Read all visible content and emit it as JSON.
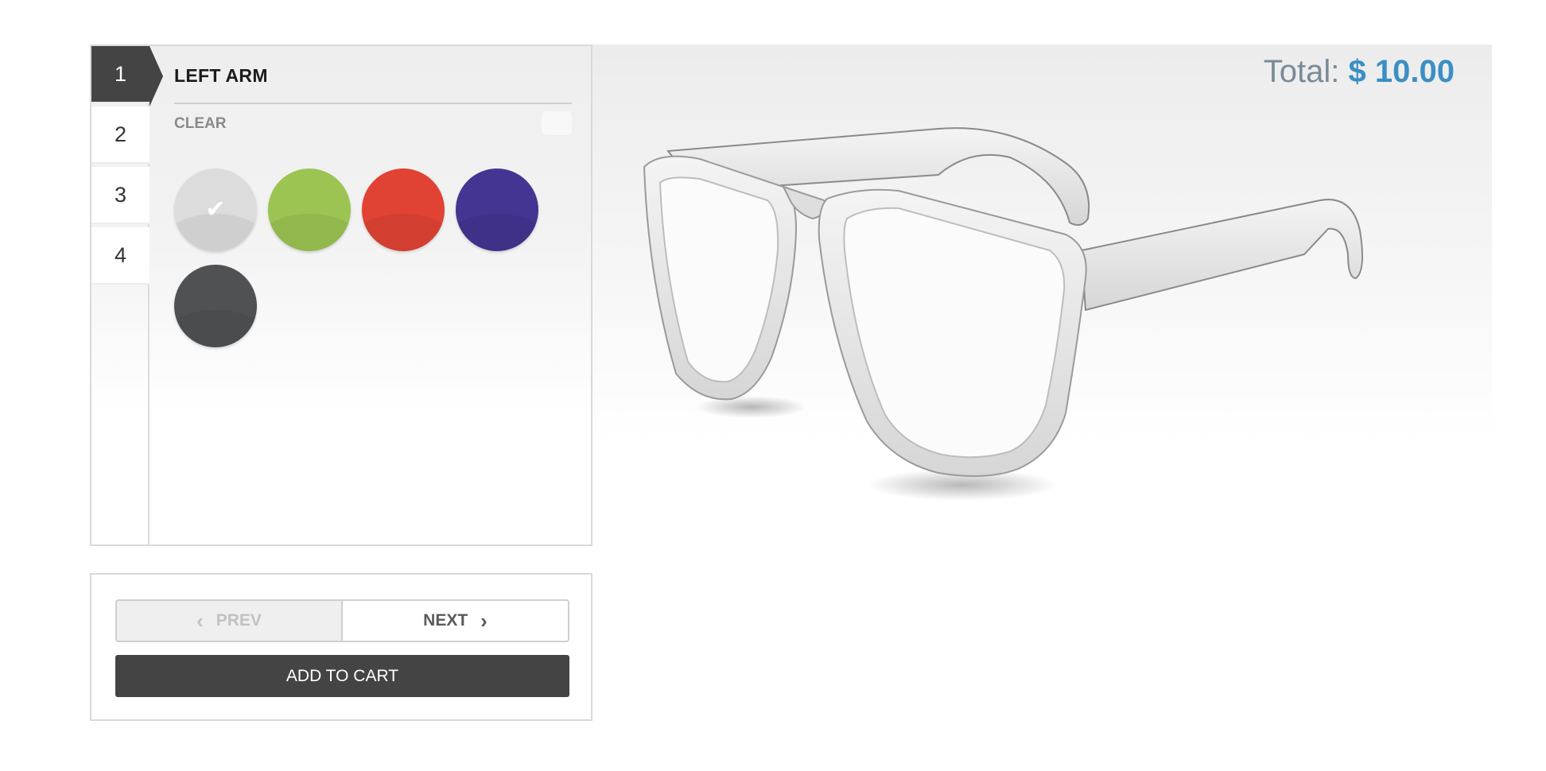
{
  "steps": [
    {
      "label": "1"
    },
    {
      "label": "2"
    },
    {
      "label": "3"
    },
    {
      "label": "4"
    }
  ],
  "active_step": 1,
  "part": {
    "title": "LEFT ARM",
    "clear_label": "CLEAR"
  },
  "swatches": [
    {
      "name": "white",
      "color": "#dcdcdc",
      "selected": true,
      "check_glyph": "✔"
    },
    {
      "name": "green",
      "color": "#9cc452",
      "selected": false
    },
    {
      "name": "red",
      "color": "#e04234",
      "selected": false
    },
    {
      "name": "purple",
      "color": "#433591",
      "selected": false
    },
    {
      "name": "dark-gray",
      "color": "#505153",
      "selected": false
    }
  ],
  "nav": {
    "prev_label": "PREV",
    "next_label": "NEXT",
    "prev_icon": "chevron-left-icon",
    "next_icon": "chevron-right-icon",
    "add_to_cart_label": "ADD TO CART"
  },
  "total": {
    "label": "Total:",
    "amount": "$ 10.00"
  },
  "colors": {
    "accent": "#3b8fc4",
    "dark": "#444444",
    "glasses_frame": "#e6e6e6"
  }
}
